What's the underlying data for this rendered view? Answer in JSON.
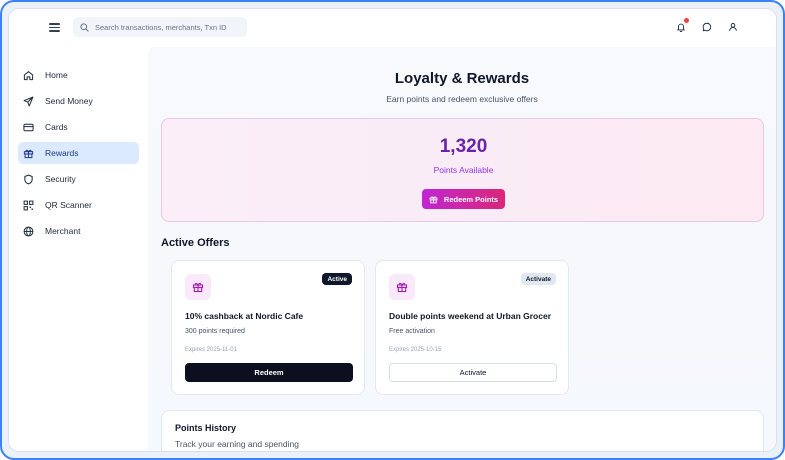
{
  "search": {
    "placeholder": "Search transactions, merchants, Txn ID"
  },
  "sidebar": {
    "items": [
      {
        "label": "Home",
        "icon": "home-icon",
        "active": false
      },
      {
        "label": "Send Money",
        "icon": "send-icon",
        "active": false
      },
      {
        "label": "Cards",
        "icon": "card-icon",
        "active": false
      },
      {
        "label": "Rewards",
        "icon": "gift-icon",
        "active": true
      },
      {
        "label": "Security",
        "icon": "shield-icon",
        "active": false
      },
      {
        "label": "QR Scanner",
        "icon": "qr-icon",
        "active": false
      },
      {
        "label": "Merchant",
        "icon": "globe-icon",
        "active": false
      }
    ]
  },
  "page": {
    "title": "Loyalty & Rewards",
    "subtitle": "Earn points and redeem exclusive offers"
  },
  "points": {
    "value": "1,320",
    "label": "Points Available",
    "button_label": "Redeem Points"
  },
  "offers": {
    "section_title": "Active Offers",
    "items": [
      {
        "title": "10% cashback at Nordic Cafe",
        "requirement": "300 points required",
        "expires": "Expires 2025-11-01",
        "badge": "Active",
        "button_label": "Redeem"
      },
      {
        "title": "Double points weekend at Urban Grocer",
        "requirement": "Free activation",
        "expires": "Expires 2025-10-15",
        "badge": "Activate",
        "button_label": "Activate"
      }
    ]
  },
  "history": {
    "title": "Points History",
    "subtitle": "Track your earning and spending"
  },
  "colors": {
    "accent": "#c026d3",
    "accent_end": "#db2777",
    "points_value": "#6b21a8",
    "nav_active_bg": "#dbeafe",
    "notification_dot": "#ef4444"
  }
}
